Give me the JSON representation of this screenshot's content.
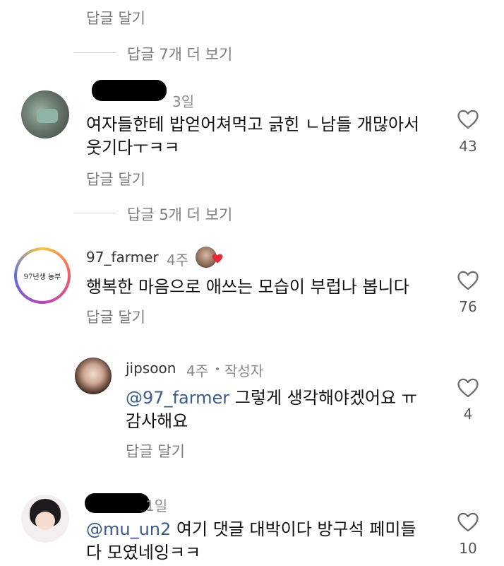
{
  "top": {
    "reply_label": "답글 달기"
  },
  "thread1": {
    "view_replies": "답글 7개 더 보기"
  },
  "comment1": {
    "time": "3일",
    "text_line1": "여자들한테 밥얻어쳐먹고 긁힌 ㄴ남들 개많아서",
    "text_line2": "웃기다ㅜㅋㅋ",
    "likes": "43",
    "reply_label": "답글 달기"
  },
  "thread2": {
    "view_replies": "답글 5개 더 보기"
  },
  "comment2": {
    "username": "97_farmer",
    "time": "4주",
    "avatar_text": "97년생 농부",
    "text": "행복한 마음으로 애쓰는 모습이 부럽나 봅니다",
    "likes": "76",
    "reply_label": "답글 달기"
  },
  "reply1": {
    "username": "jipsoon",
    "time": "4주",
    "author_badge": "작성자",
    "mention": "@97_farmer",
    "text_line1": " 그렇게 생각해야겠어요 ㅠ",
    "text_line2": "감사해요",
    "likes": "4",
    "reply_label": "답글 달기"
  },
  "comment3": {
    "time": "1일",
    "mention": "@mu_un2",
    "text_line1": " 여기 댓글 대박이다 방구석 페미들",
    "text_line2": "다 모였네잉ㅋㅋ",
    "likes": "10"
  },
  "colors": {
    "heart_outline": "#6b6b6b",
    "mention": "#3b5a8a",
    "reaction_heart": "#e8283a"
  },
  "icons": [
    "heart-outline-icon",
    "heart-reaction-icon"
  ]
}
